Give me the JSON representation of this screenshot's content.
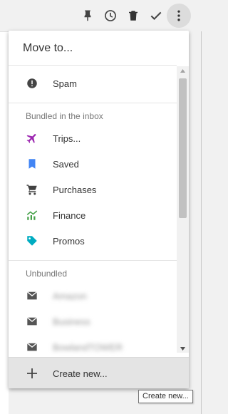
{
  "menu": {
    "title": "Move to...",
    "spam_label": "Spam",
    "bundled_section_label": "Bundled in the inbox",
    "bundled_items": [
      {
        "label": "Trips...",
        "icon": "airplane-icon",
        "color": "#9c27b0"
      },
      {
        "label": "Saved",
        "icon": "bookmark-icon",
        "color": "#4285f4"
      },
      {
        "label": "Purchases",
        "icon": "shopping-cart-icon",
        "color": "#424242"
      },
      {
        "label": "Finance",
        "icon": "finance-chart-icon",
        "color": "#43a047"
      },
      {
        "label": "Promos",
        "icon": "tag-icon",
        "color": "#00acc1"
      }
    ],
    "unbundled_section_label": "Unbundled",
    "unbundled_items": [
      {
        "label": "Amazon",
        "icon": "label-icon"
      },
      {
        "label": "Business",
        "icon": "label-icon"
      },
      {
        "label": "BowlandTOWER",
        "icon": "label-icon"
      }
    ],
    "create_new_label": "Create new..."
  },
  "tooltip": {
    "text": "Create new..."
  },
  "toolbar": {
    "icons": [
      "pin-icon",
      "snooze-clock-icon",
      "trash-icon",
      "done-check-icon",
      "more-vert-icon"
    ]
  }
}
